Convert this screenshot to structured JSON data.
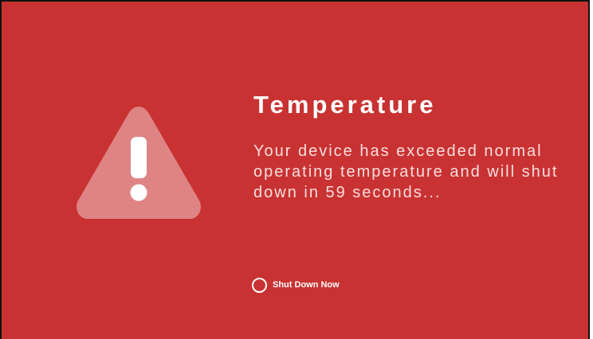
{
  "alert": {
    "icon": "warning-triangle-icon",
    "title": "Temperature",
    "message": "Your device has exceeded normal operating temperature and will shut down in 59 seconds...",
    "countdown_seconds": 59
  },
  "actions": {
    "shutdown_label": "Shut Down Now",
    "shutdown_icon": "radio-circle-icon"
  },
  "colors": {
    "background": "#c93232",
    "icon_fill": "#de8484",
    "text": "#ffffff"
  }
}
